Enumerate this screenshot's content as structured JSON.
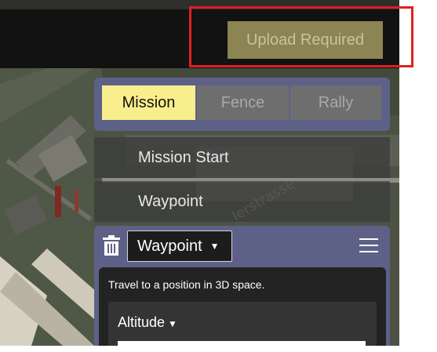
{
  "toolbar": {
    "upload_label": "Upload Required"
  },
  "plan_panel": {
    "tabs": [
      {
        "label": "Mission",
        "active": true
      },
      {
        "label": "Fence",
        "active": false
      },
      {
        "label": "Rally",
        "active": false
      }
    ],
    "items": [
      {
        "label": "Mission Start"
      },
      {
        "label": "Waypoint"
      }
    ]
  },
  "editor": {
    "command_label": "Waypoint",
    "description": "Travel to a position in 3D space.",
    "altitude_label": "Altitude",
    "icons": [
      "trash-icon",
      "hamburger-menu-icon",
      "chevron-down-icon"
    ]
  },
  "colors": {
    "accent_active_tab": "#f9ee8c",
    "panel": "#5d6187",
    "upload_button": "#8c8452",
    "highlight_box": "#e02020"
  }
}
